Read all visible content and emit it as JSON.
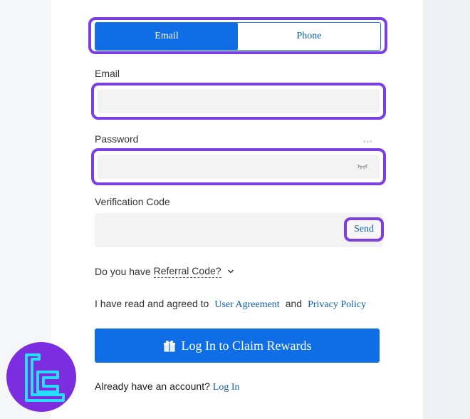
{
  "tabs": {
    "email_label": "Email",
    "phone_label": "Phone"
  },
  "email": {
    "label": "Email",
    "value": ""
  },
  "password": {
    "label": "Password",
    "value": ""
  },
  "verification": {
    "label": "Verification Code",
    "value": "",
    "send_label": "Send"
  },
  "referral": {
    "prefix": "Do you have",
    "link": "Referral Code?"
  },
  "agreement": {
    "text": "I have read and agreed to",
    "user_agreement": "User Agreement",
    "and": "and",
    "privacy_policy": "Privacy Policy"
  },
  "cta": {
    "label": "Log In to Claim Rewards"
  },
  "footer": {
    "text": "Already have an account?",
    "login_link": "Log In"
  },
  "colors": {
    "primary": "#0f6ee6",
    "highlight": "#7b3fe4",
    "link": "#0f5fa8",
    "logo_bg": "#7d2de0",
    "logo_fg": "#27e0ff"
  },
  "icons": {
    "cta_icon": "gift-icon",
    "password_toggle": "eye-closed-icon",
    "referral_toggle": "chevron-down-icon",
    "watermark": "tradingfinder-logo"
  }
}
